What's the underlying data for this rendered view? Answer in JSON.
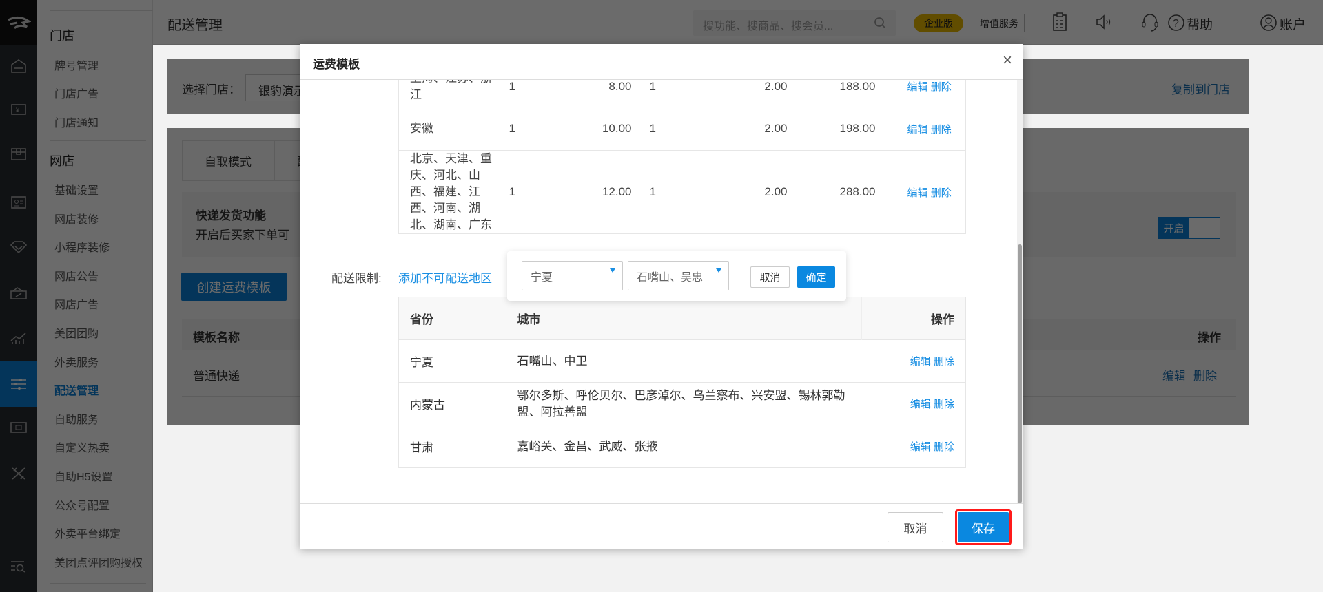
{
  "colors": {
    "accent": "#0a7fd6",
    "link": "#1a8fe3",
    "badge": "#e8b800",
    "highlight": "#ff1a1a"
  },
  "rail": {
    "icons": [
      "logo-icon",
      "home-icon",
      "cash-icon",
      "box-icon",
      "member-card-icon",
      "diamond-icon",
      "coupon-icon",
      "chart-icon",
      "sliders-icon",
      "device-icon",
      "tools-icon",
      "search-list-icon"
    ],
    "active": "sliders-icon"
  },
  "sidebar": {
    "section1": "门店",
    "section1_items": [
      "牌号管理",
      "门店广告",
      "门店通知"
    ],
    "section2": "网店",
    "section2_items": [
      "基础设置",
      "网店装修",
      "小程序装修",
      "网店公告",
      "网店广告",
      "美团团购",
      "外卖服务",
      "配送管理",
      "自助服务",
      "自定义热卖",
      "自助H5设置",
      "公众号配置",
      "外卖平台绑定",
      "美团点评团购授权"
    ],
    "active": "配送管理"
  },
  "header": {
    "title": "配送管理",
    "search_placeholder": "搜功能、搜商品、搜会员...",
    "badge": "企业版",
    "value_service": "增值服务",
    "help": "帮助",
    "account": "账户"
  },
  "main": {
    "store_label": "选择门店：",
    "store_value": "银豹演示",
    "copy_link": "复制到门店",
    "tabs": [
      "自取模式",
      "配送模式"
    ],
    "express_title": "快递发货功能",
    "express_desc": "开启后买家下单可",
    "toggle_label": "开启",
    "toggle_on": true,
    "create_button": "创建运费模板",
    "table_headers": {
      "name": "模板名称",
      "ops": "操作"
    },
    "rows": [
      {
        "name": "普通快递",
        "edit": "编辑",
        "delete": "删除"
      }
    ]
  },
  "modal": {
    "title": "运费模板",
    "close": "×",
    "fee_rows": [
      {
        "region": "上海、江苏、浙江",
        "first": "1",
        "first_fee": "8.00",
        "extra": "1",
        "extra_fee": "2.00",
        "free": "188.00",
        "edit": "编辑",
        "delete": "删除"
      },
      {
        "region": "安徽",
        "first": "1",
        "first_fee": "10.00",
        "extra": "1",
        "extra_fee": "2.00",
        "free": "198.00",
        "edit": "编辑",
        "delete": "删除"
      },
      {
        "region": "北京、天津、重庆、河北、山西、福建、江西、河南、湖北、湖南、广东",
        "first": "1",
        "first_fee": "12.00",
        "extra": "1",
        "extra_fee": "2.00",
        "free": "288.00",
        "edit": "编辑",
        "delete": "删除"
      }
    ],
    "restrict_label": "配送限制:",
    "restrict_link": "添加不可配送地区",
    "popover": {
      "province": "宁夏",
      "cities": "石嘴山、吴忠",
      "cancel": "取消",
      "confirm": "确定"
    },
    "restrict_headers": {
      "province": "省份",
      "city": "城市",
      "ops": "操作"
    },
    "restrict_rows": [
      {
        "province": "宁夏",
        "city": "石嘴山、中卫",
        "edit": "编辑",
        "delete": "删除"
      },
      {
        "province": "内蒙古",
        "city": "鄂尔多斯、呼伦贝尔、巴彦淖尔、乌兰察布、兴安盟、锡林郭勒盟、阿拉善盟",
        "edit": "编辑",
        "delete": "删除"
      },
      {
        "province": "甘肃",
        "city": "嘉峪关、金昌、武威、张掖",
        "edit": "编辑",
        "delete": "删除"
      }
    ],
    "cancel": "取消",
    "save": "保存"
  }
}
